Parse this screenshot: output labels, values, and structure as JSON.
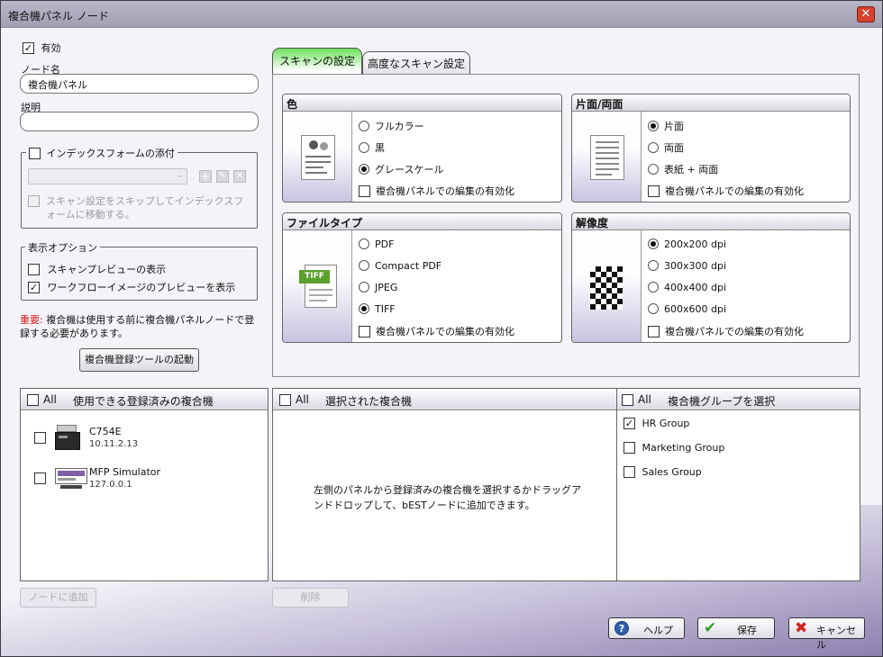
{
  "window": {
    "title": "複合機パネル ノード"
  },
  "left": {
    "enabled_label": "有効",
    "node_name_label": "ノード名",
    "node_name_value": "複合機パネル",
    "description_label": "説明",
    "description_value": "",
    "index_form_label": "インデックスフォームの添付",
    "index_form_skip_label": "スキャン設定をスキップしてインデックスフォームに移動する。",
    "display_options_label": "表示オプション",
    "scan_preview_label": "スキャンプレビューの表示",
    "workflow_preview_label": "ワークフローイメージのプレビューを表示",
    "important_prefix": "重要:",
    "important_text": " 複合機は使用する前に複合機パネルノードで登録する必要があります。",
    "launch_button": "複合機登録ツールの起動"
  },
  "tabs": {
    "scan_settings": "スキャンの設定",
    "advanced_scan": "高度なスキャン設定"
  },
  "color_box": {
    "title": "色",
    "options": [
      "フルカラー",
      "黒",
      "グレースケール"
    ],
    "selected_index": 2,
    "enable_edit": "複合機パネルでの編集の有効化"
  },
  "sides_box": {
    "title": "片面/両面",
    "options": [
      "片面",
      "両面",
      "表紙 + 両面"
    ],
    "selected_index": 0,
    "enable_edit": "複合機パネルでの編集の有効化"
  },
  "filetype_box": {
    "title": "ファイルタイプ",
    "options": [
      "PDF",
      "Compact PDF",
      "JPEG",
      "TIFF"
    ],
    "selected_index": 3,
    "thumb_label": "TIFF",
    "enable_edit": "複合機パネルでの編集の有効化"
  },
  "resolution_box": {
    "title": "解像度",
    "options": [
      "200x200 dpi",
      "300x300 dpi",
      "400x400 dpi",
      "600x600 dpi"
    ],
    "selected_index": 0,
    "enable_edit": "複合機パネルでの編集の有効化"
  },
  "available_panel": {
    "all_label": "All",
    "title": "使用できる登録済みの複合機",
    "devices": [
      {
        "name": "C754E",
        "ip": "10.11.2.13"
      },
      {
        "name": "MFP Simulator",
        "ip": "127.0.0.1"
      }
    ]
  },
  "selected_panel": {
    "all_label": "All",
    "title": "選択された複合機",
    "hint": "左側のパネルから登録済みの複合機を選択するかドラッグアンドドロップして、bESTノードに追加できます。"
  },
  "group_panel": {
    "all_label": "All",
    "title": "複合機グループを選択",
    "groups": [
      {
        "name": "HR Group",
        "checked": true
      },
      {
        "name": "Marketing Group",
        "checked": false
      },
      {
        "name": "Sales Group",
        "checked": false
      }
    ]
  },
  "bottom": {
    "add_node": "ノードに追加",
    "delete": "削除",
    "help": "ヘルプ",
    "save": "保存",
    "cancel": "キャンセル"
  }
}
